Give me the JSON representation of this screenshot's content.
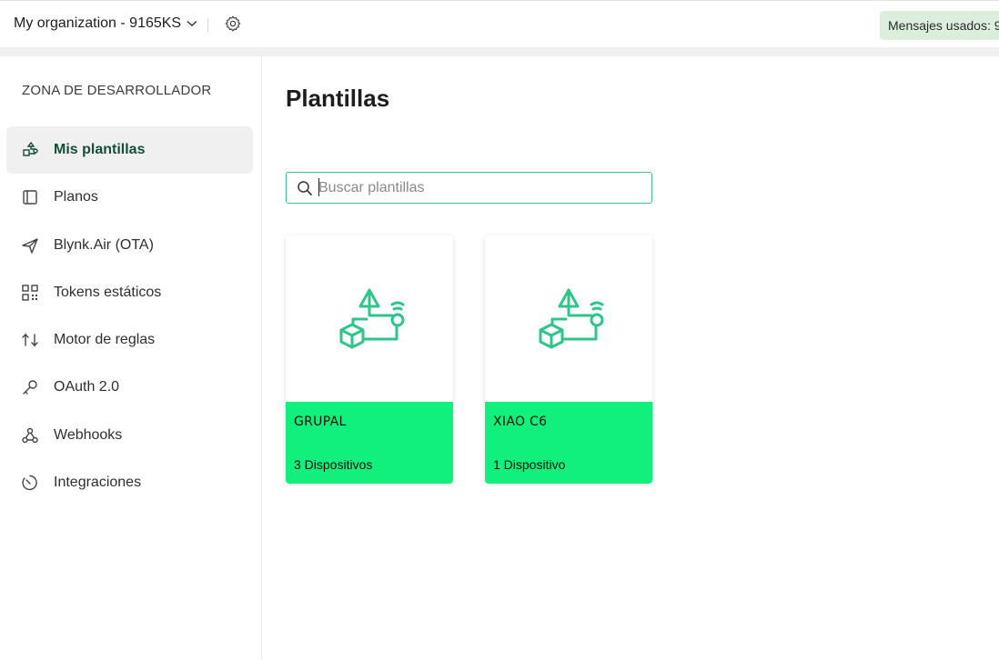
{
  "header": {
    "org_name": "My organization - 9165KS",
    "messages_label": "Mensajes usados: 9"
  },
  "sidebar": {
    "heading": "ZONA DE DESARROLLADOR",
    "items": [
      {
        "label": "Mis plantillas",
        "icon": "templates-icon",
        "active": true
      },
      {
        "label": "Planos",
        "icon": "blueprint-icon"
      },
      {
        "label": "Blynk.Air (OTA)",
        "icon": "paper-plane-icon"
      },
      {
        "label": "Tokens estáticos",
        "icon": "qr-code-icon"
      },
      {
        "label": "Motor de reglas",
        "icon": "rules-icon"
      },
      {
        "label": "OAuth 2.0",
        "icon": "key-icon"
      },
      {
        "label": "Webhooks",
        "icon": "webhook-icon"
      },
      {
        "label": "Integraciones",
        "icon": "integrations-icon"
      }
    ]
  },
  "main": {
    "title": "Plantillas",
    "search_placeholder": "Buscar plantillas",
    "cards": [
      {
        "name": "GRUPAL",
        "devices": "3 Dispositivos"
      },
      {
        "name": "XIAO C6",
        "devices": "1 Dispositivo"
      }
    ]
  },
  "colors": {
    "accent": "#11f07d",
    "icon_green": "#2fc58a",
    "active_text": "#134f34"
  }
}
